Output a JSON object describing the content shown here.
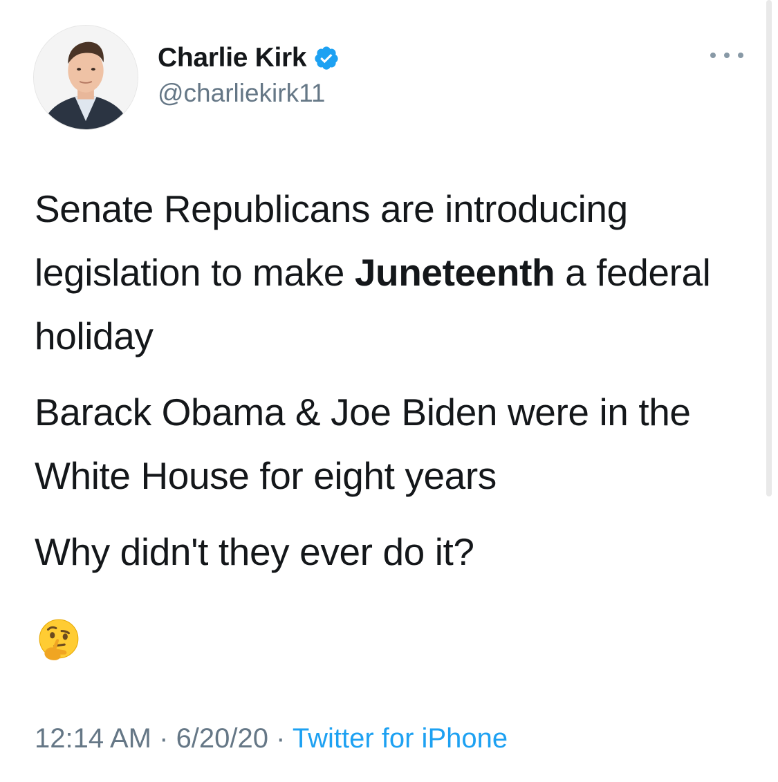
{
  "author": {
    "display_name": "Charlie Kirk",
    "handle": "@charliekirk11",
    "verified": true,
    "avatar_icon": "profile-photo",
    "verified_color": "#1da1f2"
  },
  "menu": {
    "icon": "more-horizontal-icon"
  },
  "tweet": {
    "paragraphs": [
      {
        "before": "Senate Republicans are introducing legislation to make ",
        "bold": "Juneteenth",
        "after": " a federal holiday"
      },
      {
        "text": "Barack Obama & Joe Biden were in the White House for eight years"
      },
      {
        "text": "Why didn't they ever do it?"
      }
    ],
    "emoji": "thinking-face-emoji"
  },
  "meta": {
    "time": "12:14 AM",
    "separator": " · ",
    "date": "6/20/20",
    "source": "Twitter for iPhone"
  },
  "colors": {
    "text": "#14171a",
    "secondary": "#657786",
    "link": "#1da1f2"
  }
}
